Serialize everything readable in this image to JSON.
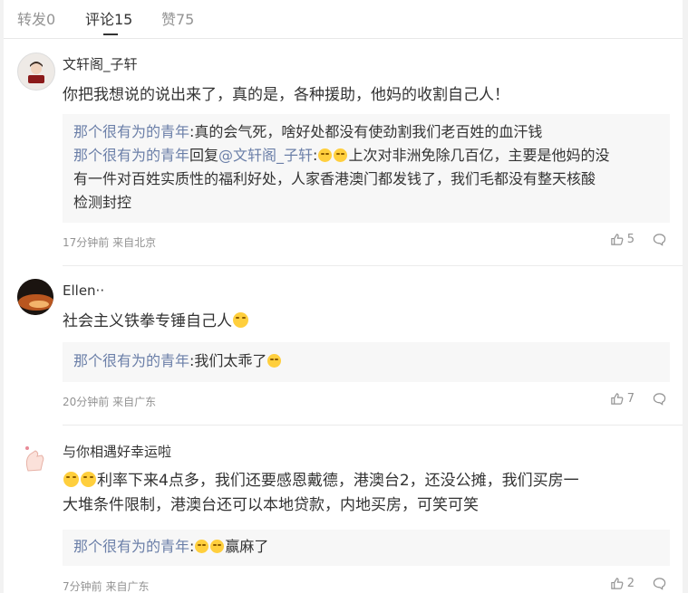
{
  "tabs": [
    {
      "label": "转发0"
    },
    {
      "label": "评论15"
    },
    {
      "label": "赞75"
    }
  ],
  "comments": [
    {
      "username": "文轩阁_子轩",
      "text": "你把我想说的说出来了，真的是，各种援助，他妈的收割自己人！",
      "replies": [
        {
          "author": "那个很有为的青年",
          "sep": ":",
          "text": "真的会气死，啥好处都没有使劲割我们老百姓的血汗钱"
        },
        {
          "author": "那个很有为的青年",
          "mid": "回复",
          "mention": "@文轩阁_子轩",
          "sep": ":",
          "emoji": "laugh-cry-emoji",
          "text1": "上次对非洲免除几百亿，主要是他妈的没",
          "text2": "有一件对百姓实质性的福利好处，人家香港澳门都发钱了，我们毛都没有整天核酸",
          "text3": "检测封控"
        }
      ],
      "meta": "17分钟前 来自北京",
      "likes": "5"
    },
    {
      "username": "Ellen··",
      "text": "社会主义铁拳专锤自己人",
      "emoji": "laugh-cry-emoji",
      "replies": [
        {
          "author": "那个很有为的青年",
          "sep": ":",
          "text": "我们太乖了",
          "emoji": "party-emoji"
        }
      ],
      "meta": "20分钟前 来自广东",
      "likes": "7"
    },
    {
      "username": "与你相遇好幸运啦",
      "text1": "利率下来4点多，我们还要感恩戴德，港澳台2，还没公摊，我们买房一",
      "text2": "大堆条件限制，港澳台还可以本地贷款，内地买房，可笑可笑",
      "emoji": "laugh-cry-emoji",
      "replies": [
        {
          "author": "那个很有为的青年",
          "sep": ":",
          "text": "赢麻了",
          "emoji": "tired-emoji"
        }
      ],
      "meta": "7分钟前 来自广东",
      "likes": "2"
    }
  ],
  "colors": {
    "link": "#6b7fa8",
    "muted": "#939393",
    "reply_bg": "#f7f7f7"
  }
}
